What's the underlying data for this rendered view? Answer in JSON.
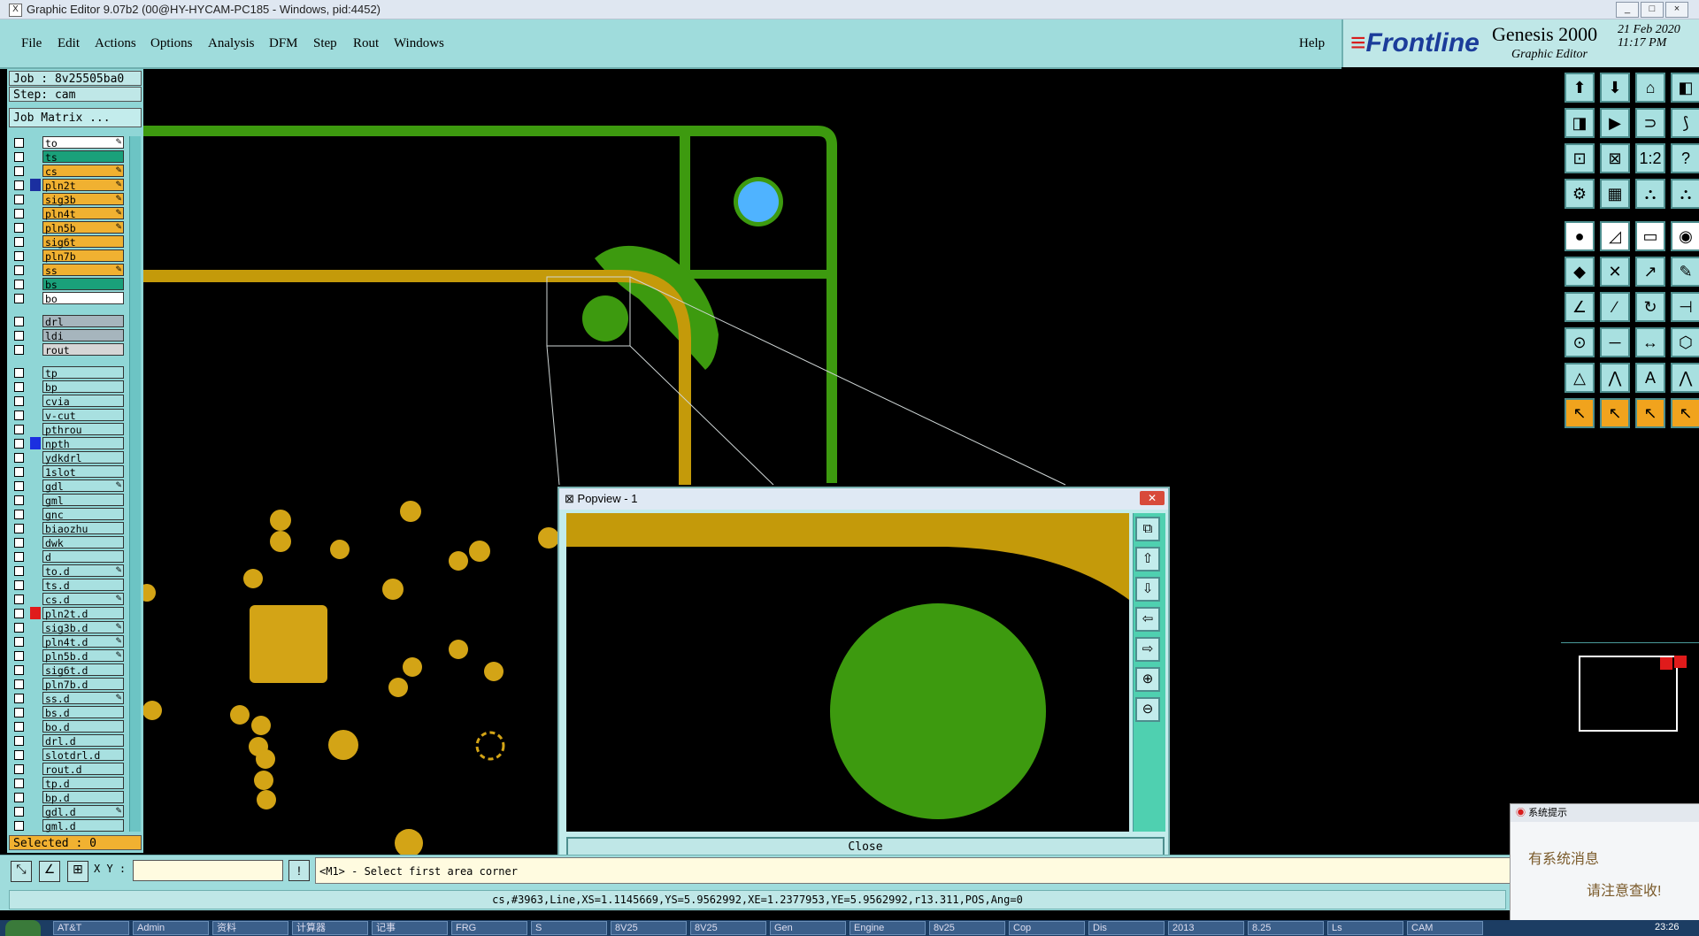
{
  "window": {
    "title": "Graphic Editor 9.07b2 (00@HY-HYCAM-PC185 - Windows, pid:4452)",
    "min": "_",
    "max": "□",
    "close": "×",
    "app_icon": "X"
  },
  "menu": {
    "items": [
      "File",
      "Edit",
      "Actions",
      "Options",
      "Analysis",
      "DFM",
      "Step",
      "Rout",
      "Windows"
    ],
    "help": "Help"
  },
  "brand": {
    "logo": "Frontline",
    "product": "Genesis 2000",
    "sub": "Graphic Editor",
    "date": "21 Feb 2020",
    "time": "11:17 PM"
  },
  "job": {
    "job_label": "Job : 8v25505ba0",
    "step_label": "Step: cam",
    "matrix_btn": "Job Matrix ..."
  },
  "layers": [
    {
      "name": "to",
      "color": "#ffffff",
      "edit": true
    },
    {
      "name": "ts",
      "color": "#1aa07a",
      "edit": false
    },
    {
      "name": "cs",
      "color": "#f0b131",
      "edit": true
    },
    {
      "name": "pln2t",
      "color": "#f0b131",
      "edit": true,
      "marker": "#1b2fa0"
    },
    {
      "name": "sig3b",
      "color": "#f0b131",
      "edit": true
    },
    {
      "name": "pln4t",
      "color": "#f0b131",
      "edit": true
    },
    {
      "name": "pln5b",
      "color": "#f0b131",
      "edit": true
    },
    {
      "name": "sig6t",
      "color": "#f0b131",
      "edit": false
    },
    {
      "name": "pln7b",
      "color": "#f0b131",
      "edit": false
    },
    {
      "name": "ss",
      "color": "#f0b131",
      "edit": true
    },
    {
      "name": "bs",
      "color": "#1aa07a",
      "edit": false
    },
    {
      "name": "bo",
      "color": "#ffffff",
      "edit": false
    },
    {
      "name": "drl",
      "color": "#a6b5bd",
      "edit": false
    },
    {
      "name": "ldi",
      "color": "#a6b5bd",
      "edit": false
    },
    {
      "name": "rout",
      "color": "#d6d6d6",
      "edit": false
    },
    {
      "name": "tp",
      "color": "#a8e0e0",
      "edit": false
    },
    {
      "name": "bp",
      "color": "#a8e0e0",
      "edit": false
    },
    {
      "name": "cvia",
      "color": "#a8e0e0",
      "edit": false
    },
    {
      "name": "v-cut",
      "color": "#a8e0e0",
      "edit": false
    },
    {
      "name": "pthrou",
      "color": "#a8e0e0",
      "edit": false
    },
    {
      "name": "npth",
      "color": "#a8e0e0",
      "edit": false,
      "marker": "#1b2fe0"
    },
    {
      "name": "ydkdrl",
      "color": "#a8e0e0",
      "edit": false
    },
    {
      "name": "1slot",
      "color": "#a8e0e0",
      "edit": false
    },
    {
      "name": "gdl",
      "color": "#a8e0e0",
      "edit": true
    },
    {
      "name": "gml",
      "color": "#a8e0e0",
      "edit": false
    },
    {
      "name": "gnc",
      "color": "#a8e0e0",
      "edit": false
    },
    {
      "name": "biaozhu",
      "color": "#a8e0e0",
      "edit": false
    },
    {
      "name": "dwk",
      "color": "#a8e0e0",
      "edit": false
    },
    {
      "name": "d",
      "color": "#a8e0e0",
      "edit": false
    },
    {
      "name": "to.d",
      "color": "#a8e0e0",
      "edit": true
    },
    {
      "name": "ts.d",
      "color": "#a8e0e0",
      "edit": false
    },
    {
      "name": "cs.d",
      "color": "#a8e0e0",
      "edit": true
    },
    {
      "name": "pln2t.d",
      "color": "#a8e0e0",
      "edit": false,
      "marker": "#e01b1b"
    },
    {
      "name": "sig3b.d",
      "color": "#a8e0e0",
      "edit": true
    },
    {
      "name": "pln4t.d",
      "color": "#a8e0e0",
      "edit": true
    },
    {
      "name": "pln5b.d",
      "color": "#a8e0e0",
      "edit": true
    },
    {
      "name": "sig6t.d",
      "color": "#a8e0e0",
      "edit": false
    },
    {
      "name": "pln7b.d",
      "color": "#a8e0e0",
      "edit": false
    },
    {
      "name": "ss.d",
      "color": "#a8e0e0",
      "edit": true
    },
    {
      "name": "bs.d",
      "color": "#a8e0e0",
      "edit": false
    },
    {
      "name": "bo.d",
      "color": "#a8e0e0",
      "edit": false
    },
    {
      "name": "drl.d",
      "color": "#a8e0e0",
      "edit": false
    },
    {
      "name": "slotdrl.d",
      "color": "#a8e0e0",
      "edit": false
    },
    {
      "name": "rout.d",
      "color": "#a8e0e0",
      "edit": false
    },
    {
      "name": "tp.d",
      "color": "#a8e0e0",
      "edit": false
    },
    {
      "name": "bp.d",
      "color": "#a8e0e0",
      "edit": false
    },
    {
      "name": "gdl.d",
      "color": "#a8e0e0",
      "edit": true
    },
    {
      "name": "gml.d",
      "color": "#a8e0e0",
      "edit": false
    }
  ],
  "selected": "Selected : 0",
  "cmd": {
    "xy_label": "X Y :",
    "xy_value": "",
    "excl": "!",
    "prompt": "<M1> - Select first area corner"
  },
  "status": "cs,#3963,Line,XS=1.1145669,YS=5.9562992,XE=1.2377953,YE=5.9562992,r13.311,POS,Ang=0",
  "popview": {
    "title": "Popview - 1",
    "close": "Close"
  },
  "notification": {
    "title": "系统提示",
    "line1": "有系统消息",
    "line2": "请注意查收!"
  },
  "taskbar": {
    "time": "23:26",
    "items": [
      "AT&T",
      "Admin",
      "资料",
      "计算器",
      "记事",
      "FRG",
      "S",
      "8V25",
      "8V25",
      "Gen",
      "Engine",
      "8v25",
      "Cop",
      "Dis",
      "2013",
      "8.25",
      "Ls",
      "CAM"
    ]
  },
  "colors": {
    "green": "#3d9a0f",
    "gold": "#c49a0a",
    "pad_gold": "#d3a416",
    "cyan_pad": "#4fb3ff"
  }
}
